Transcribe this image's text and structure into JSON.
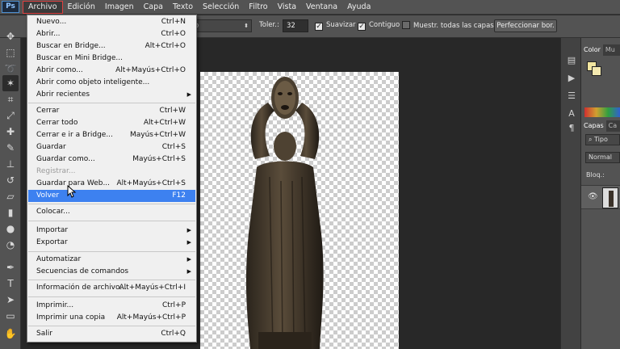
{
  "menubar": {
    "logo": "Ps",
    "items": [
      "Archivo",
      "Edición",
      "Imagen",
      "Capa",
      "Texto",
      "Selección",
      "Filtro",
      "Vista",
      "Ventana",
      "Ayuda"
    ]
  },
  "options": {
    "sample_dropdown": "o",
    "tolerance_label": "Toler.:",
    "tolerance_value": "32",
    "antialias_label": "Suavizar",
    "antialias_checked": true,
    "contiguous_label": "Contiguo",
    "contiguous_checked": true,
    "all_layers_label": "Muestr. todas las capas",
    "all_layers_checked": false,
    "refine_button": "Perfeccionar bor."
  },
  "file_menu": {
    "items": [
      {
        "label": "Nuevo...",
        "shortcut": "Ctrl+N"
      },
      {
        "label": "Abrir...",
        "shortcut": "Ctrl+O"
      },
      {
        "label": "Buscar en Bridge...",
        "shortcut": "Alt+Ctrl+O"
      },
      {
        "label": "Buscar en Mini Bridge...",
        "shortcut": ""
      },
      {
        "label": "Abrir como...",
        "shortcut": "Alt+Mayús+Ctrl+O"
      },
      {
        "label": "Abrir como objeto inteligente...",
        "shortcut": ""
      },
      {
        "label": "Abrir recientes",
        "shortcut": "",
        "submenu": true
      },
      {
        "label": "Cerrar",
        "shortcut": "Ctrl+W"
      },
      {
        "label": "Cerrar todo",
        "shortcut": "Alt+Ctrl+W"
      },
      {
        "label": "Cerrar e ir a Bridge...",
        "shortcut": "Mayús+Ctrl+W"
      },
      {
        "label": "Guardar",
        "shortcut": "Ctrl+S"
      },
      {
        "label": "Guardar como...",
        "shortcut": "Mayús+Ctrl+S"
      },
      {
        "label": "Registrar...",
        "shortcut": "",
        "disabled": true
      },
      {
        "label": "Guardar para Web...",
        "shortcut": "Alt+Mayús+Ctrl+S"
      },
      {
        "label": "Volver",
        "shortcut": "F12",
        "highlighted": true
      },
      {
        "label": "Colocar...",
        "shortcut": ""
      },
      {
        "label": "Importar",
        "shortcut": "",
        "submenu": true
      },
      {
        "label": "Exportar",
        "shortcut": "",
        "submenu": true
      },
      {
        "label": "Automatizar",
        "shortcut": "",
        "submenu": true
      },
      {
        "label": "Secuencias de comandos",
        "shortcut": "",
        "submenu": true
      },
      {
        "label": "Información de archivo...",
        "shortcut": "Alt+Mayús+Ctrl+I"
      },
      {
        "label": "Imprimir...",
        "shortcut": "Ctrl+P"
      },
      {
        "label": "Imprimir una copia",
        "shortcut": "Alt+Mayús+Ctrl+P"
      },
      {
        "label": "Salir",
        "shortcut": "Ctrl+Q"
      }
    ]
  },
  "panels": {
    "color_tabs": [
      "Color",
      "Mu"
    ],
    "layers_tabs": [
      "Capas",
      "Ca"
    ],
    "filter_label": "Tipo",
    "blend_mode": "Normal",
    "lock_label": "Bloq.:"
  },
  "colors": {
    "menu_highlight": "#3d81f0",
    "active_menu_border": "#e04040",
    "ui_gray": "#535353",
    "workspace": "#282828"
  },
  "icons": {
    "toolbar": [
      "move-icon",
      "marquee-icon",
      "lasso-icon",
      "magic-wand-icon",
      "crop-icon",
      "eyedropper-icon",
      "healing-icon",
      "brush-icon",
      "stamp-icon",
      "history-brush-icon",
      "eraser-icon",
      "gradient-icon",
      "blur-icon",
      "dodge-icon",
      "pen-icon",
      "type-icon",
      "path-select-icon",
      "shape-icon",
      "hand-icon"
    ],
    "right_strip": [
      "history-icon",
      "actions-icon",
      "adjust-icon",
      "character-icon",
      "paragraph-icon"
    ]
  }
}
